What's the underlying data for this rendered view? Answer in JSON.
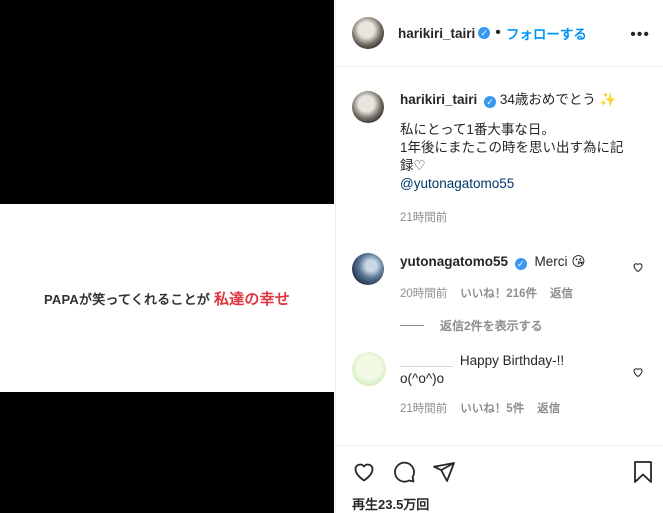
{
  "media": {
    "caption_main": "PAPAが笑ってくれることが",
    "caption_highlight": "私達の幸せ"
  },
  "header": {
    "username": "harikiri_tairi",
    "verified_mark": "✓",
    "separator": "•",
    "follow_label": "フォローする",
    "more_label": "•••"
  },
  "post": {
    "username": "harikiri_tairi",
    "text_line1": "34歳おめでとう",
    "emoji": "✨",
    "text_line2": "私にとって1番大事な日。",
    "text_line3": "1年後にまたこの時を思い出す為に記録♡",
    "mention": "@yutonagatomo55",
    "time": "21時間前"
  },
  "comments": [
    {
      "username": "yutonagatomo55",
      "text": "Merci",
      "emoji": "😘",
      "time": "20時間前",
      "likes": "いいね！216件",
      "reply_label": "返信"
    },
    {
      "username": "________",
      "text": "Happy Birthday-!!",
      "text2": "o(^o^)o",
      "time": "21時間前",
      "likes": "いいね！5件",
      "reply_label": "返信"
    }
  ],
  "view_replies": "返信2件を表示する",
  "footer": {
    "views": "再生23.5万回"
  },
  "icons": {
    "like": "heart-icon",
    "comment": "comment-icon",
    "share": "paper-plane-icon",
    "save": "bookmark-icon"
  },
  "colors": {
    "follow": "#0095f6",
    "verified": "#3897f0",
    "highlight": "#e0353f",
    "mention": "#00376b"
  }
}
